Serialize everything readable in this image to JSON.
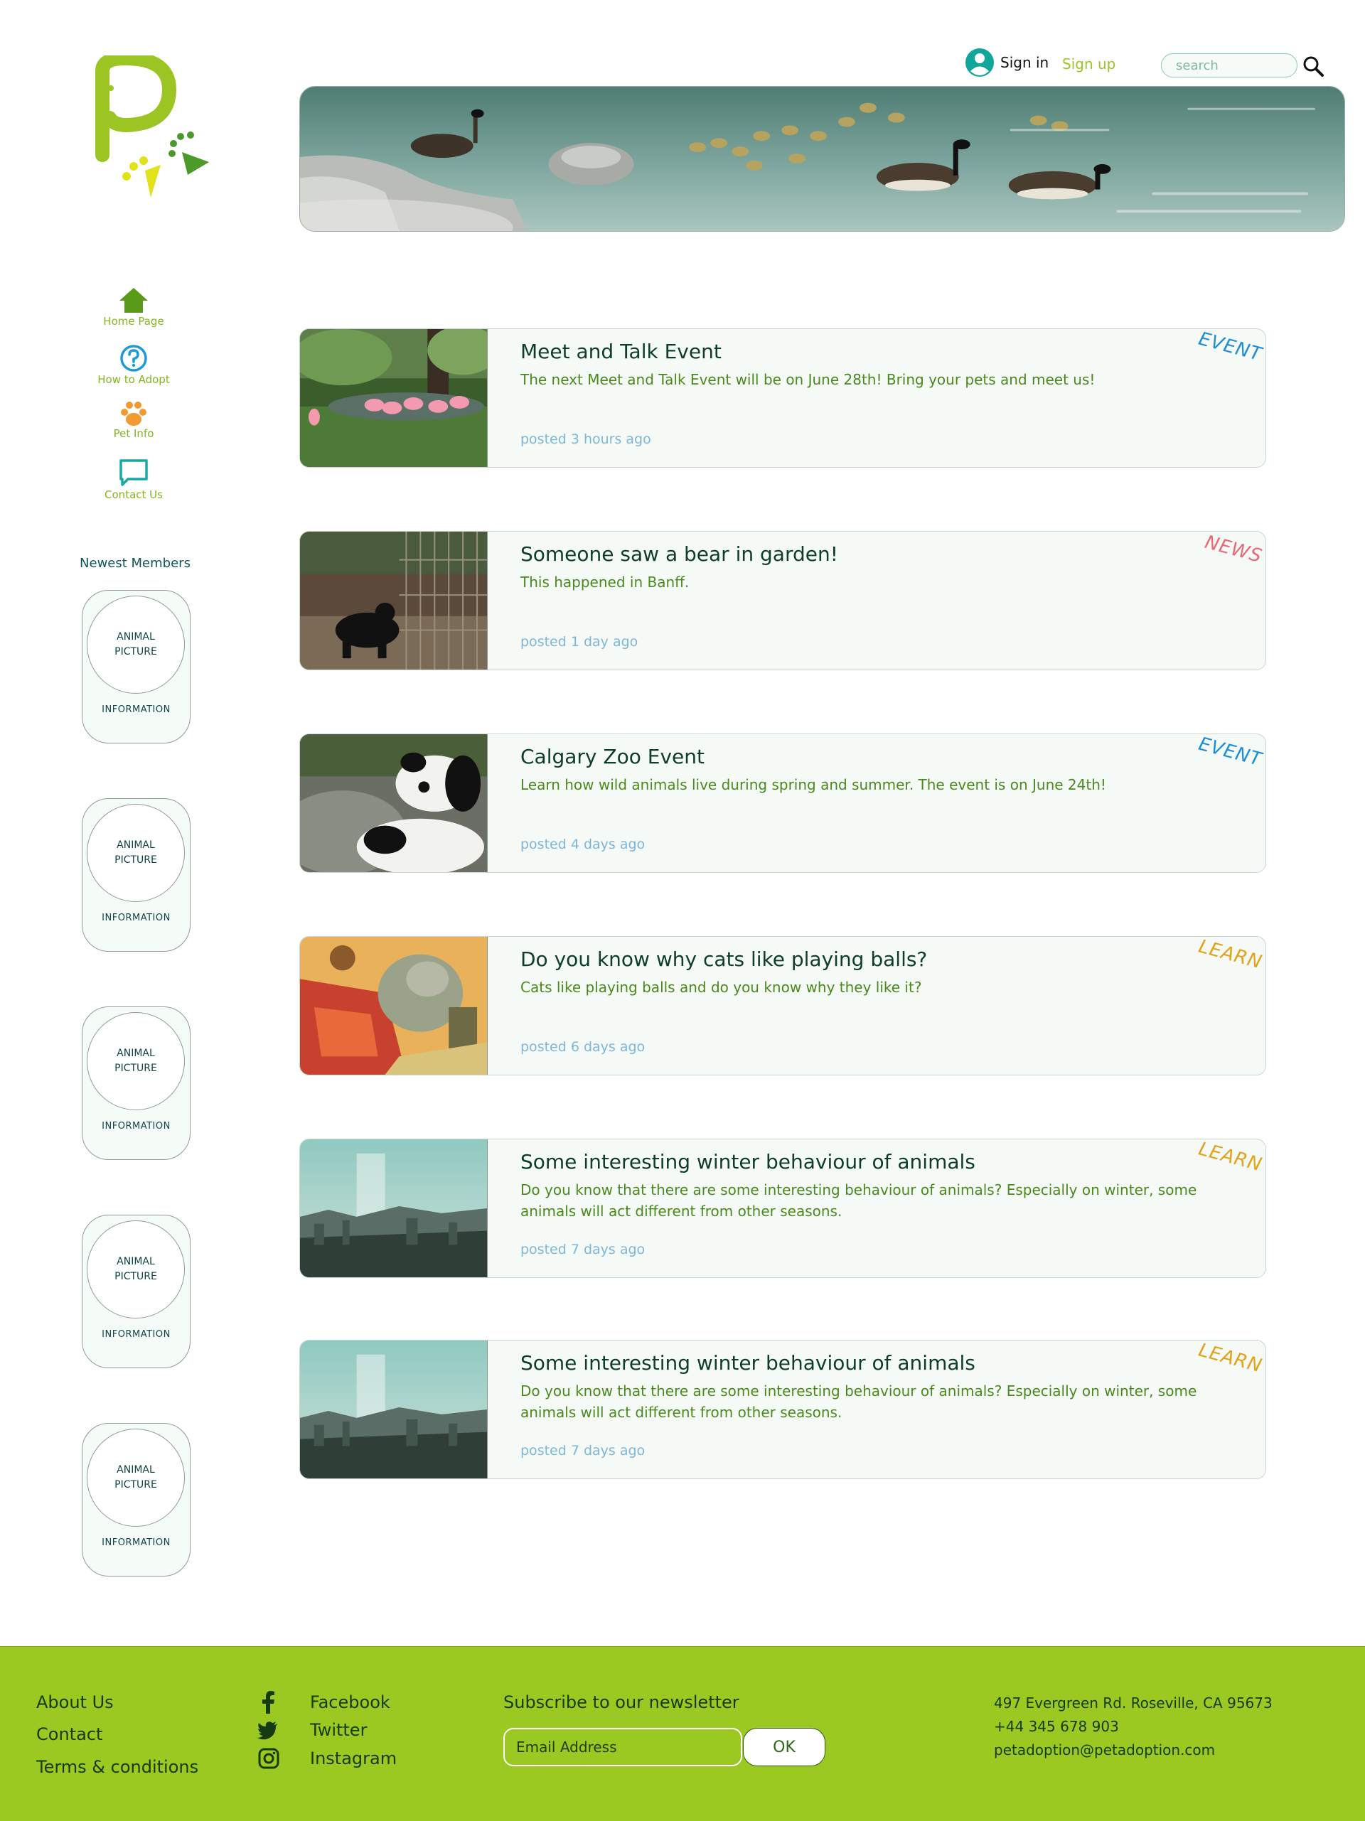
{
  "header": {
    "signin_label": "Sign in",
    "signup_label": "Sign up",
    "search_placeholder": "search"
  },
  "sidebar": {
    "nav": [
      {
        "label": "Home Page",
        "icon": "home-icon",
        "color": "#5a9a19"
      },
      {
        "label": "How to Adopt",
        "icon": "question-circle-icon",
        "color": "#1e9bd7"
      },
      {
        "label": "Pet Info",
        "icon": "paw-icon",
        "color": "#f19a32"
      },
      {
        "label": "Contact Us",
        "icon": "chat-bubble-icon",
        "color": "#19a8a0"
      }
    ],
    "newest_members_title": "Newest Members",
    "members": [
      {
        "picture": "ANIMAL PICTURE",
        "info": "INFORMATION"
      },
      {
        "picture": "ANIMAL PICTURE",
        "info": "INFORMATION"
      },
      {
        "picture": "ANIMAL PICTURE",
        "info": "INFORMATION"
      },
      {
        "picture": "ANIMAL PICTURE",
        "info": "INFORMATION"
      },
      {
        "picture": "ANIMAL PICTURE",
        "info": "INFORMATION"
      }
    ]
  },
  "posts": [
    {
      "title": "Meet and Talk Event",
      "body": "The next Meet and Talk Event will be on June 28th! Bring your pets and meet us!",
      "time": "posted 3 hours ago",
      "tag": "EVENT",
      "tag_color": "#1e8fd6",
      "thumb": "flamingos"
    },
    {
      "title": "Someone saw a bear in garden!",
      "body": "This happened in Banff.",
      "time": "posted 1 day ago",
      "tag": "NEWS",
      "tag_color": "#e86a78",
      "thumb": "bear"
    },
    {
      "title": "Calgary Zoo Event",
      "body": "Learn how wild animals live during spring and summer. The event is on June 24th!",
      "time": "posted 4 days ago",
      "tag": "EVENT",
      "tag_color": "#1e8fd6",
      "thumb": "pandas"
    },
    {
      "title": "Do you know why cats like playing balls?",
      "body": "Cats like playing balls and do you know why they like it?",
      "time": "posted 6 days ago",
      "tag": "LEARN",
      "tag_color": "#e3a21a",
      "thumb": "painting"
    },
    {
      "title": "Some interesting winter behaviour of animals",
      "body": "Do you know that there are some interesting behaviour of animals? Especially on winter, some animals will act different from other seasons.",
      "time": "posted 7 days ago",
      "tag": "LEARN",
      "tag_color": "#e3a21a",
      "thumb": "city"
    },
    {
      "title": "Some interesting winter behaviour of animals",
      "body": "Do you know that there are some interesting behaviour of animals? Especially on winter, some animals will act different from other seasons.",
      "time": "posted 7 days ago",
      "tag": "LEARN",
      "tag_color": "#e3a21a",
      "thumb": "city"
    }
  ],
  "footer": {
    "links": [
      "About Us",
      "Contact",
      "Terms & conditions"
    ],
    "social": [
      {
        "label": "Facebook",
        "icon": "facebook-icon"
      },
      {
        "label": "Twitter",
        "icon": "twitter-icon"
      },
      {
        "label": "Instagram",
        "icon": "instagram-icon"
      }
    ],
    "newsletter_title": "Subscribe to our newsletter",
    "email_placeholder": "Email Address",
    "ok_label": "OK",
    "address": "497 Evergreen Rd. Roseville, CA 95673",
    "phone": "+44 345 678 903",
    "email": "petadoption@petadoption.com"
  }
}
